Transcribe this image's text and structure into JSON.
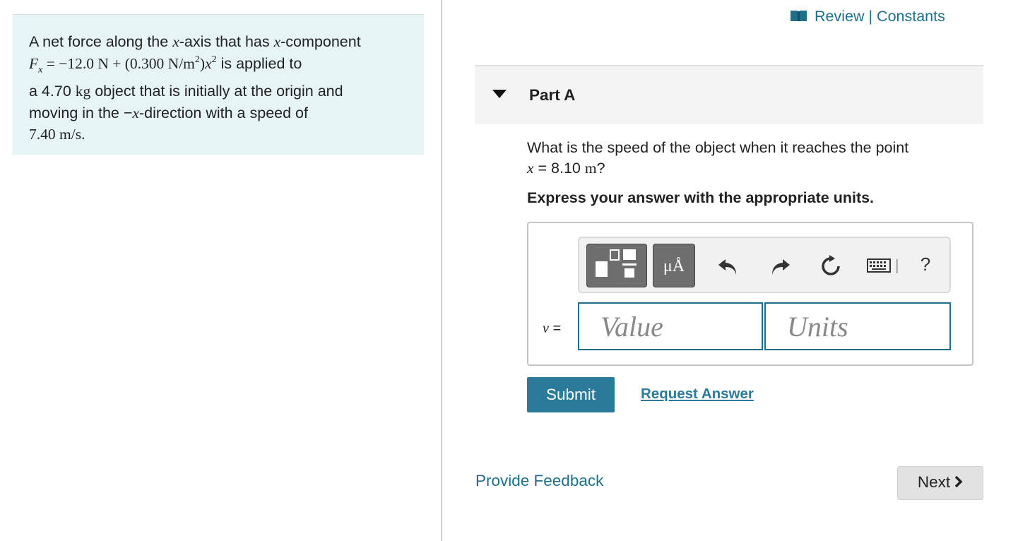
{
  "problem": {
    "line1_a": "A net force along the ",
    "x": "x",
    "line1_b": "-axis that has ",
    "line1_c": "-component",
    "fx_sym": "F",
    "fx_sub": "x",
    "fx_eq": " = −12.0 N + (0.300 N/m",
    "exp2": "2",
    "fx_close": ")",
    "line2_end": " is applied to",
    "line3_a": "a 4.70 ",
    "kg": "kg",
    "line3_b": " object that is initially at the origin and",
    "line4_a": "moving in the −",
    "line4_b": "-direction with a speed of",
    "line5": "7.40 m/s."
  },
  "header": {
    "review": "Review",
    "separator": " | ",
    "constants": "Constants"
  },
  "part": {
    "title": "Part A",
    "question_a": "What is the speed of the object when it reaches the point",
    "question_var": "x",
    "question_b": " = 8.10 ",
    "question_unit": "m",
    "question_end": "?",
    "instruction": "Express your answer with the appropriate units."
  },
  "answer": {
    "variable": "v",
    "equals": " =",
    "units_button_label": "μÅ",
    "help_label": "?",
    "value_placeholder": "Value",
    "units_placeholder": "Units"
  },
  "actions": {
    "submit": "Submit",
    "request_answer": "Request Answer",
    "provide_feedback": "Provide Feedback",
    "next": "Next"
  },
  "colors": {
    "accent": "#2b7a99",
    "link": "#1f6f8b",
    "panel": "#e6f4f6"
  }
}
